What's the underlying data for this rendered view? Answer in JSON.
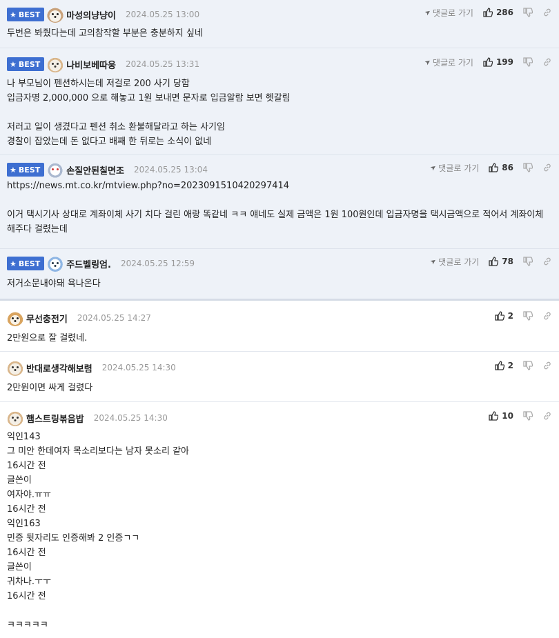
{
  "labels": {
    "best": "BEST",
    "reply": "댓글로 가기"
  },
  "colors": {
    "badge": "#3e6fd1",
    "best_bg": "#eef2f8",
    "date": "#999999"
  },
  "comments": [
    {
      "best": true,
      "avatar": "dog-icon",
      "nick": "마성의냥냥이",
      "date": "2024.05.25 13:00",
      "likes": "286",
      "text": "두번은 봐줬다는데 고의참작할 부분은 충분하지 싶네"
    },
    {
      "best": true,
      "avatar": "puppy-icon",
      "nick": "나비보베따웅",
      "date": "2024.05.25 13:31",
      "likes": "199",
      "text": "나 부모님이 펜션하시는데 저걸로 200 사기 당함\n입금자명 2,000,000 으로 해놓고 1원 보내면 문자로 입금알람 보면 헷갈림\n\n저러고 일이 생겼다고 펜션 취소 환불해달라고 하는 사기임\n경찰이 잡았는데 돈 없다고 배째 한 뒤로는 소식이 없네"
    },
    {
      "best": true,
      "avatar": "robot-icon",
      "nick": "손질안된칠면조",
      "date": "2024.05.25 13:04",
      "likes": "86",
      "text": "https://news.mt.co.kr/mtview.php?no=2023091510420297414\n\n이거 택시기사 상대로 계좌이체 사기 치다 걸린 애랑 똑같네 ㅋㅋ 얘네도 실제 금액은 1원 100원인데 입금자명을 택시금액으로 적어서 계좌이체 해주다 걸렸는데"
    },
    {
      "best": true,
      "avatar": "bear-icon",
      "nick": "주드벨링엄.",
      "date": "2024.05.25 12:59",
      "likes": "78",
      "text": "저거소문내야돼 욕나온다"
    },
    {
      "best": false,
      "avatar": "fox-icon",
      "nick": "무선충전기",
      "date": "2024.05.25 14:27",
      "likes": "2",
      "text": "2만원으로 잘 걸렸네."
    },
    {
      "best": false,
      "avatar": "puppy-icon",
      "nick": "반대로생각해보렴",
      "date": "2024.05.25 14:30",
      "likes": "2",
      "text": "2만원이면 싸게 걸렸다"
    },
    {
      "best": false,
      "avatar": "puppy-icon",
      "nick": "햄스트링볶음밥",
      "date": "2024.05.25 14:30",
      "likes": "10",
      "text": "익인143\n그 미안 한데여자 목소리보다는 남자 못소리 같아\n16시간 전\n글쓴이\n여자야.ㅠㅠ\n16시간 전\n익인163\n민증 뒷자리도 인증해봐 2 인증ㄱㄱ\n16시간 전\n글쓴이\n귀차나.ㅜㅜ\n16시간 전\n\nㅋㅋㅋㅋㅋ"
    }
  ]
}
